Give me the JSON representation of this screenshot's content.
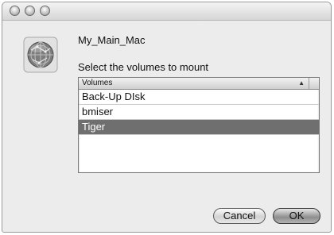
{
  "dialog": {
    "server_name": "My_Main_Mac",
    "prompt": "Select the volumes to mount"
  },
  "icons": {
    "server": "server-globe-icon",
    "sort": "sort-ascending-icon"
  },
  "list": {
    "header": "Volumes",
    "sort_glyph": "▲",
    "items": [
      {
        "label": "Back-Up DIsk",
        "selected": false
      },
      {
        "label": "bmiser",
        "selected": false
      },
      {
        "label": "Tiger",
        "selected": true
      }
    ]
  },
  "buttons": {
    "cancel": "Cancel",
    "ok": "OK"
  }
}
